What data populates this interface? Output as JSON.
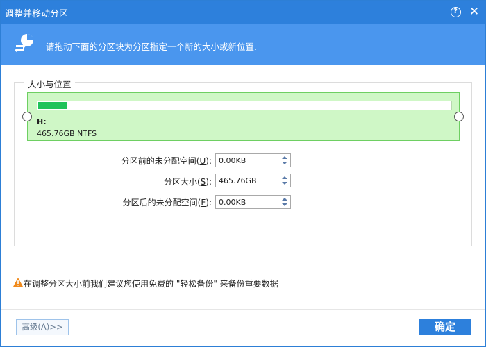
{
  "window": {
    "title": "调整并移动分区",
    "help_label": "?",
    "close_label": "✕"
  },
  "banner": {
    "icon": "partition-move-icon",
    "text": "请拖动下面的分区块为分区指定一个新的大小或新位置."
  },
  "group": {
    "legend": "大小与位置"
  },
  "partition": {
    "label": "H:",
    "size_fs": "465.76GB NTFS",
    "used_fraction": 0.07,
    "colors": {
      "fill": "#1fc35a",
      "background": "#cff7c6",
      "border": "#6ecf62"
    }
  },
  "fields": [
    {
      "label_prefix": "分区前的未分配空间(",
      "mnemonic": "U",
      "label_suffix": "):",
      "value": "0.00KB"
    },
    {
      "label_prefix": "分区大小(",
      "mnemonic": "S",
      "label_suffix": "):",
      "value": "465.76GB"
    },
    {
      "label_prefix": "分区后的未分配空间(",
      "mnemonic": "F",
      "label_suffix": "):",
      "value": "0.00KB"
    }
  ],
  "warning": {
    "icon": "warning-icon",
    "text": "在调整分区大小前我们建议您使用免费的 \"轻松备份\" 来备份重要数据"
  },
  "footer": {
    "advanced_button": "高级(A)>>",
    "ok_button": "确定"
  },
  "colors": {
    "accent": "#2d80dc",
    "banner": "#4a96ee"
  }
}
